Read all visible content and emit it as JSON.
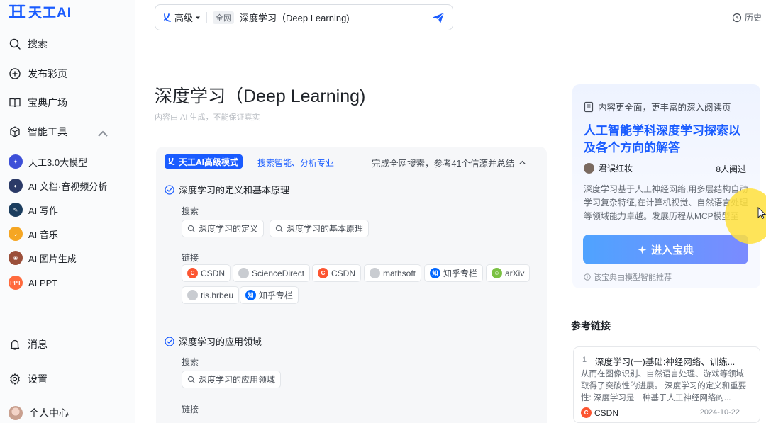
{
  "app": {
    "logo_text": "天工AI"
  },
  "sidebar": {
    "nav": [
      {
        "label": "搜索",
        "icon": "search-icon"
      },
      {
        "label": "发布彩页",
        "icon": "plus-circle-icon"
      },
      {
        "label": "宝典广场",
        "icon": "book-icon"
      },
      {
        "label": "智能工具",
        "icon": "cube-icon"
      }
    ],
    "tools": [
      {
        "label": "天工3.0大模型",
        "icon": "model-icon",
        "color": "#3d4fd8"
      },
      {
        "label": "AI 文档·音视频分析",
        "icon": "doc-analysis-icon",
        "color": "#2b3a67"
      },
      {
        "label": "AI 写作",
        "icon": "writing-icon",
        "color": "#1b3d5e"
      },
      {
        "label": "AI 音乐",
        "icon": "music-icon",
        "color": "#f5a623"
      },
      {
        "label": "AI 图片生成",
        "icon": "image-gen-icon",
        "color": "#9b4f3a"
      },
      {
        "label": "AI PPT",
        "icon": "ppt-icon",
        "color": "#ff6a3d",
        "badge": "PPT"
      }
    ],
    "bottom": [
      {
        "label": "消息",
        "icon": "bell-icon"
      },
      {
        "label": "设置",
        "icon": "settings-icon"
      },
      {
        "label": "个人中心",
        "icon": "avatar"
      }
    ]
  },
  "search": {
    "mode_label": "高级",
    "scope_tag": "全网",
    "query": "深度学习（Deep Learning)"
  },
  "header": {
    "history_label": "历史"
  },
  "main": {
    "title": "深度学习（Deep Learning)",
    "disclaimer": "内容由 AI 生成，不能保证真实",
    "mode_badge": "天工AI高级模式",
    "mode_sub": "搜索智能、分析专业",
    "summary": "完成全网搜索，参考41个信源并总结",
    "search_label": "搜索",
    "links_label": "链接",
    "steps": [
      {
        "title": "深度学习的定义和基本原理",
        "searches": [
          "深度学习的定义",
          "深度学习的基本原理"
        ],
        "links": [
          {
            "label": "CSDN",
            "icon": "csdn-icon",
            "color": "#fc5531"
          },
          {
            "label": "ScienceDirect",
            "icon": "sciencedirect-icon",
            "color": "#c9ccd1"
          },
          {
            "label": "CSDN",
            "icon": "csdn-icon",
            "color": "#fc5531"
          },
          {
            "label": "mathsoft",
            "icon": "mathsoft-icon",
            "color": "#c9ccd1"
          },
          {
            "label": "知乎专栏",
            "icon": "zhihu-icon",
            "color": "#0066ff",
            "glyph": "知"
          },
          {
            "label": "arXiv",
            "icon": "arxiv-icon",
            "color": "#7ac142"
          },
          {
            "label": "tis.hrbeu",
            "icon": "tis-icon",
            "color": "#c9ccd1"
          },
          {
            "label": "知乎专栏",
            "icon": "zhihu-icon",
            "color": "#0066ff",
            "glyph": "知"
          }
        ]
      },
      {
        "title": "深度学习的应用领域",
        "searches": [
          "深度学习的应用领域"
        ],
        "links_label": "链接"
      }
    ]
  },
  "recommend": {
    "head": "内容更全面，更丰富的深入阅读页",
    "title": "人工智能学科深度学习探索以及各个方向的解答",
    "author": "君误红妆",
    "read_count": "8人阅过",
    "desc": "深度学习基于人工神经网络,用多层结构自动学习复杂特征,在计算机视觉、自然语言处理等领域能力卓越。发展历程从MCP模型至",
    "enter_label": "进入宝典",
    "foot": "该宝典由模型智能推荐"
  },
  "references": {
    "title": "参考链接",
    "items": [
      {
        "num": "1",
        "title": "深度学习(一)基础:神经网络、训练...",
        "body": "从而在图像识别、自然语言处理、游戏等领域取得了突破性的进展。 深度学习的定义和重要性: 深度学习是一种基于人工神经网络的...",
        "source": "CSDN",
        "source_color": "#fc5531",
        "date": "2024-10-22"
      }
    ]
  }
}
